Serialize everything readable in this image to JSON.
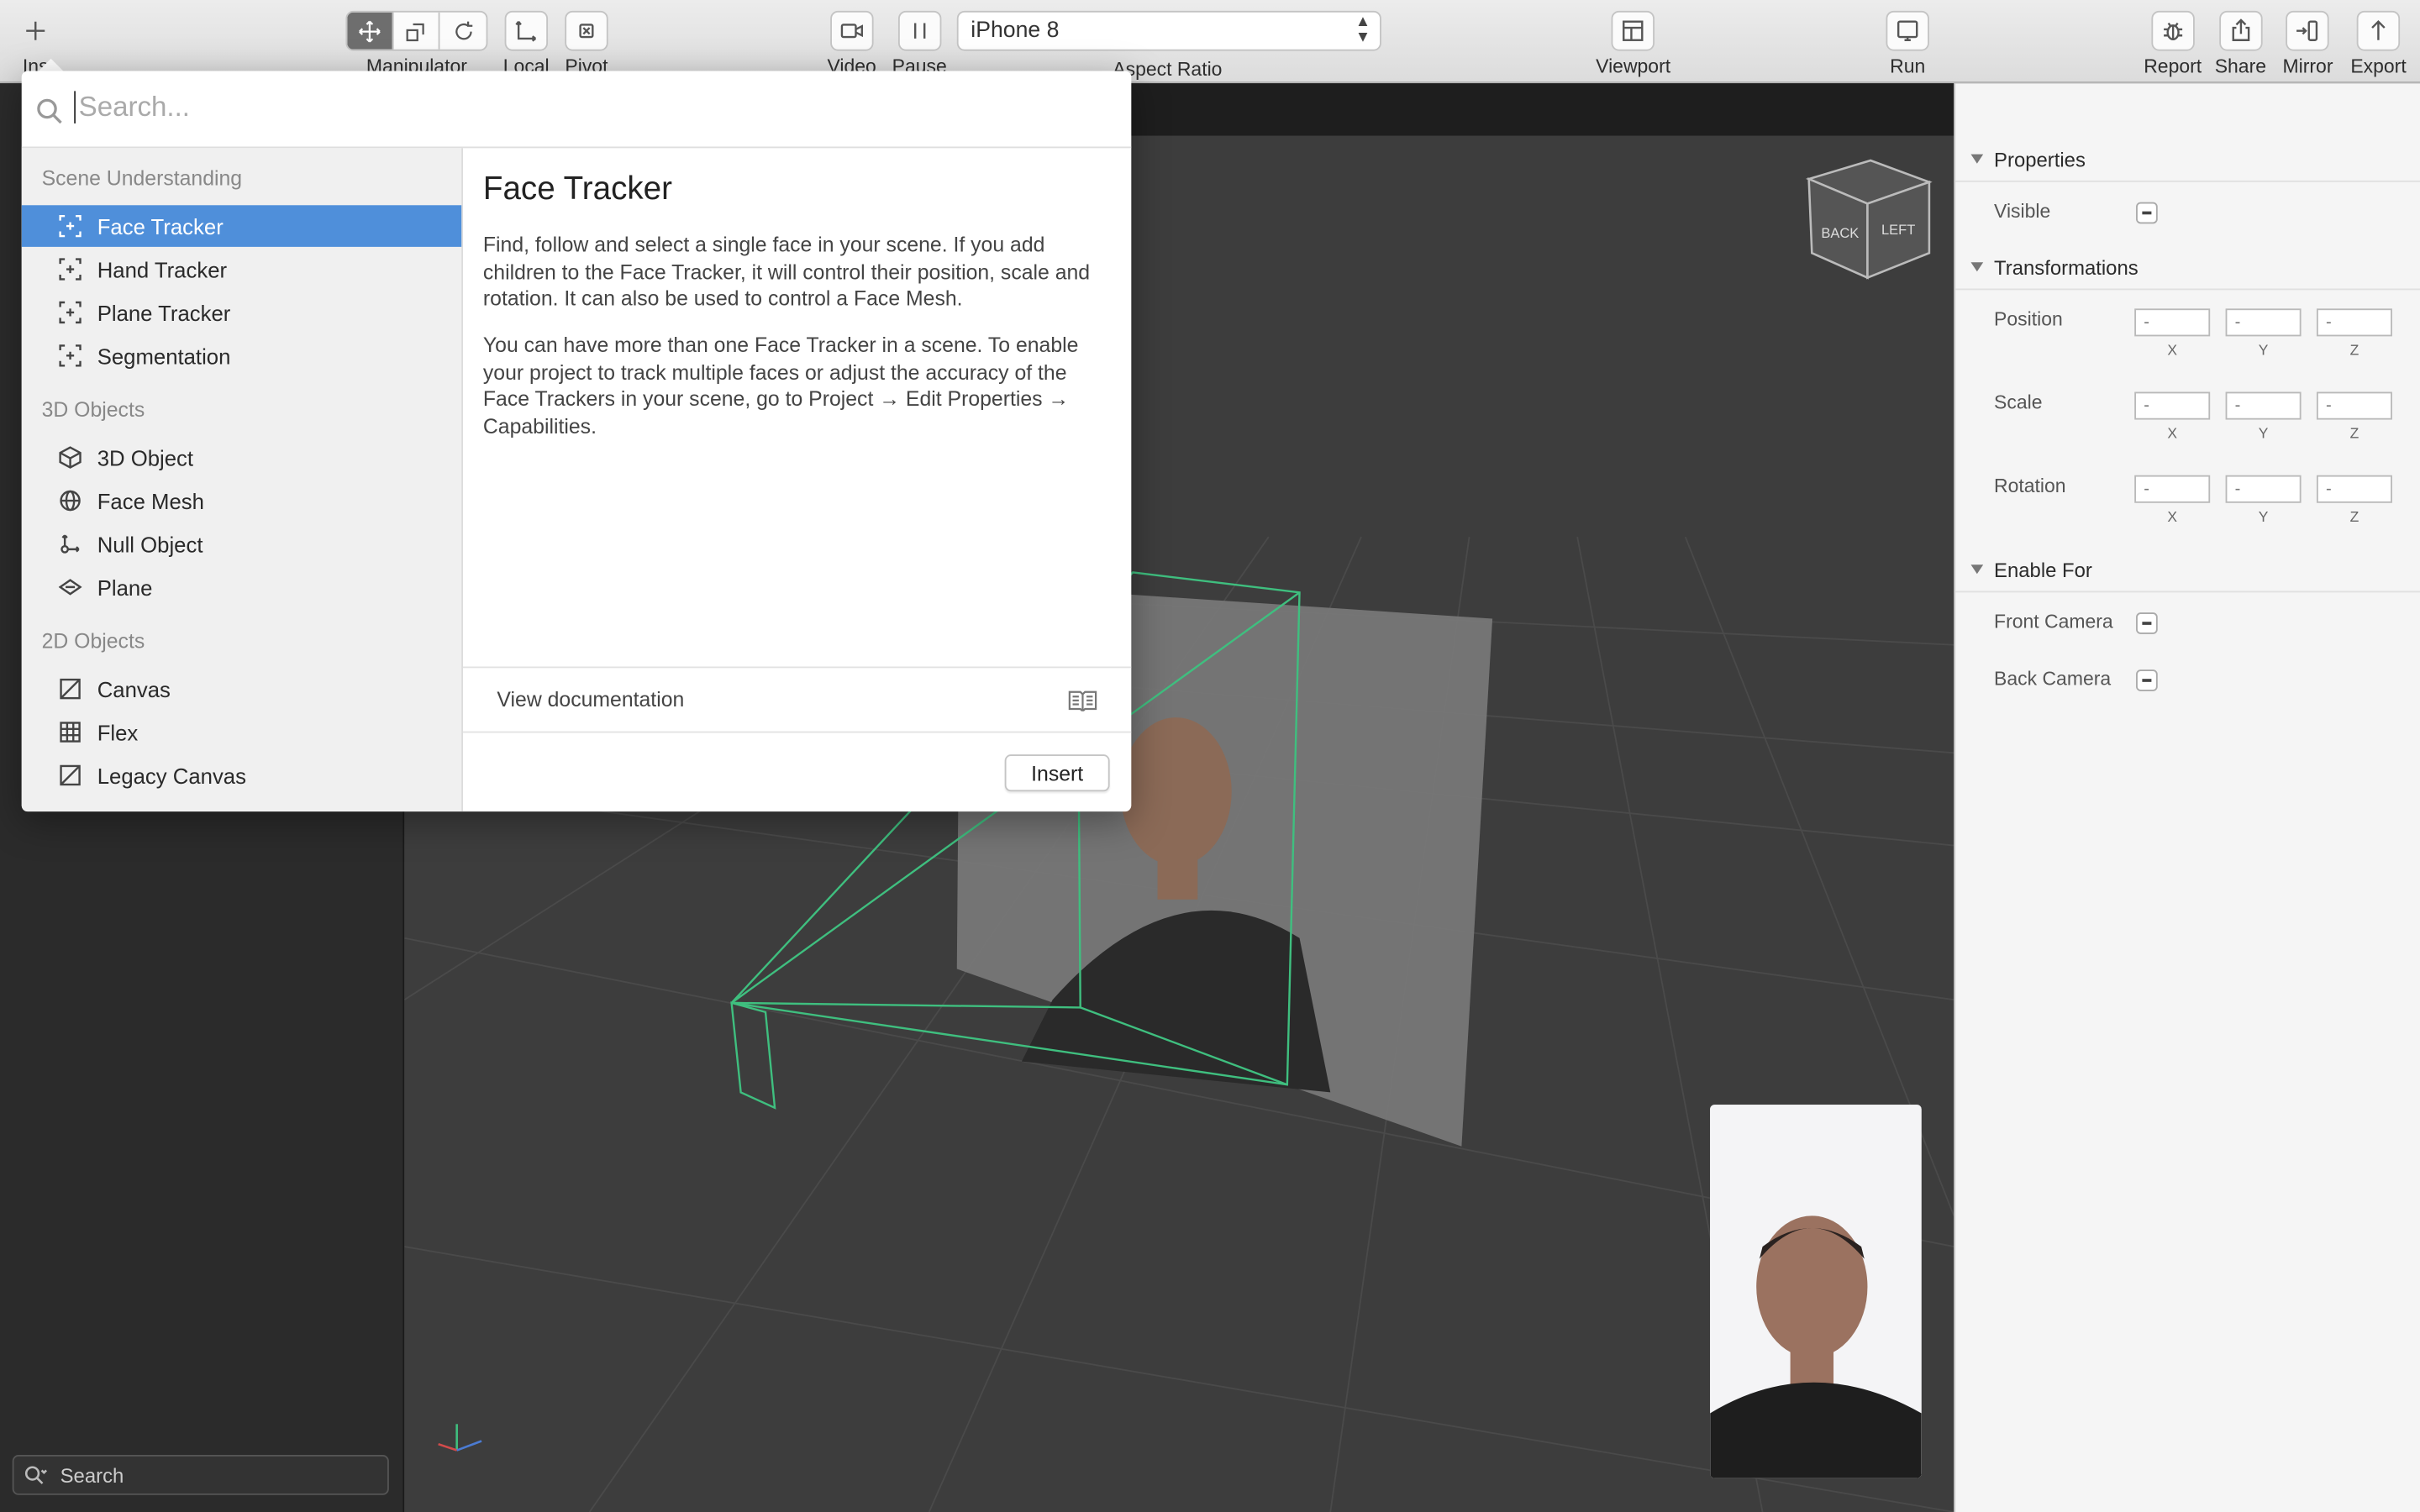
{
  "toolbar": {
    "insert_label": "Ins",
    "manipulator_label": "Manipulator",
    "local_label": "Local",
    "pivot_label": "Pivot",
    "video_label": "Video",
    "pause_label": "Pause",
    "device": "iPhone 8",
    "aspect_ratio_label": "Aspect Ratio",
    "viewport_label": "Viewport",
    "run_label": "Run",
    "report_label": "Report",
    "share_label": "Share",
    "mirror_label": "Mirror",
    "export_label": "Export"
  },
  "left_panel": {
    "search_placeholder": "Search"
  },
  "popup": {
    "search_placeholder": "Search...",
    "categories": [
      {
        "label": "Scene Understanding",
        "items": [
          "Face Tracker",
          "Hand Tracker",
          "Plane Tracker",
          "Segmentation"
        ]
      },
      {
        "label": "3D Objects",
        "items": [
          "3D Object",
          "Face Mesh",
          "Null Object",
          "Plane"
        ]
      },
      {
        "label": "2D Objects",
        "items": [
          "Canvas",
          "Flex",
          "Legacy Canvas"
        ]
      }
    ],
    "selected_item": "Face Tracker",
    "detail": {
      "title": "Face Tracker",
      "paragraph1": "Find, follow and select a single face in your scene. If you add children to the Face Tracker, it will control their position, scale and rotation. It can also be used to control a Face Mesh.",
      "paragraph2": "You can have more than one Face Tracker in a scene. To enable your project to track multiple faces or adjust the accuracy of the Face Trackers in your scene, go to Project → Edit Properties → Capabilities.",
      "doc_link": "View documentation",
      "insert_button": "Insert"
    }
  },
  "viewport": {
    "cube_back": "BACK",
    "cube_left": "LEFT"
  },
  "inspector": {
    "properties_header": "Properties",
    "visible_label": "Visible",
    "transformations_header": "Transformations",
    "position_label": "Position",
    "scale_label": "Scale",
    "rotation_label": "Rotation",
    "vector_placeholder": "-",
    "axes": [
      "X",
      "Y",
      "Z"
    ],
    "enable_for_header": "Enable For",
    "front_camera_label": "Front Camera",
    "back_camera_label": "Back Camera"
  },
  "colors": {
    "selection": "#4f8fda",
    "tracker_wireframe": "#3fbf7f"
  }
}
